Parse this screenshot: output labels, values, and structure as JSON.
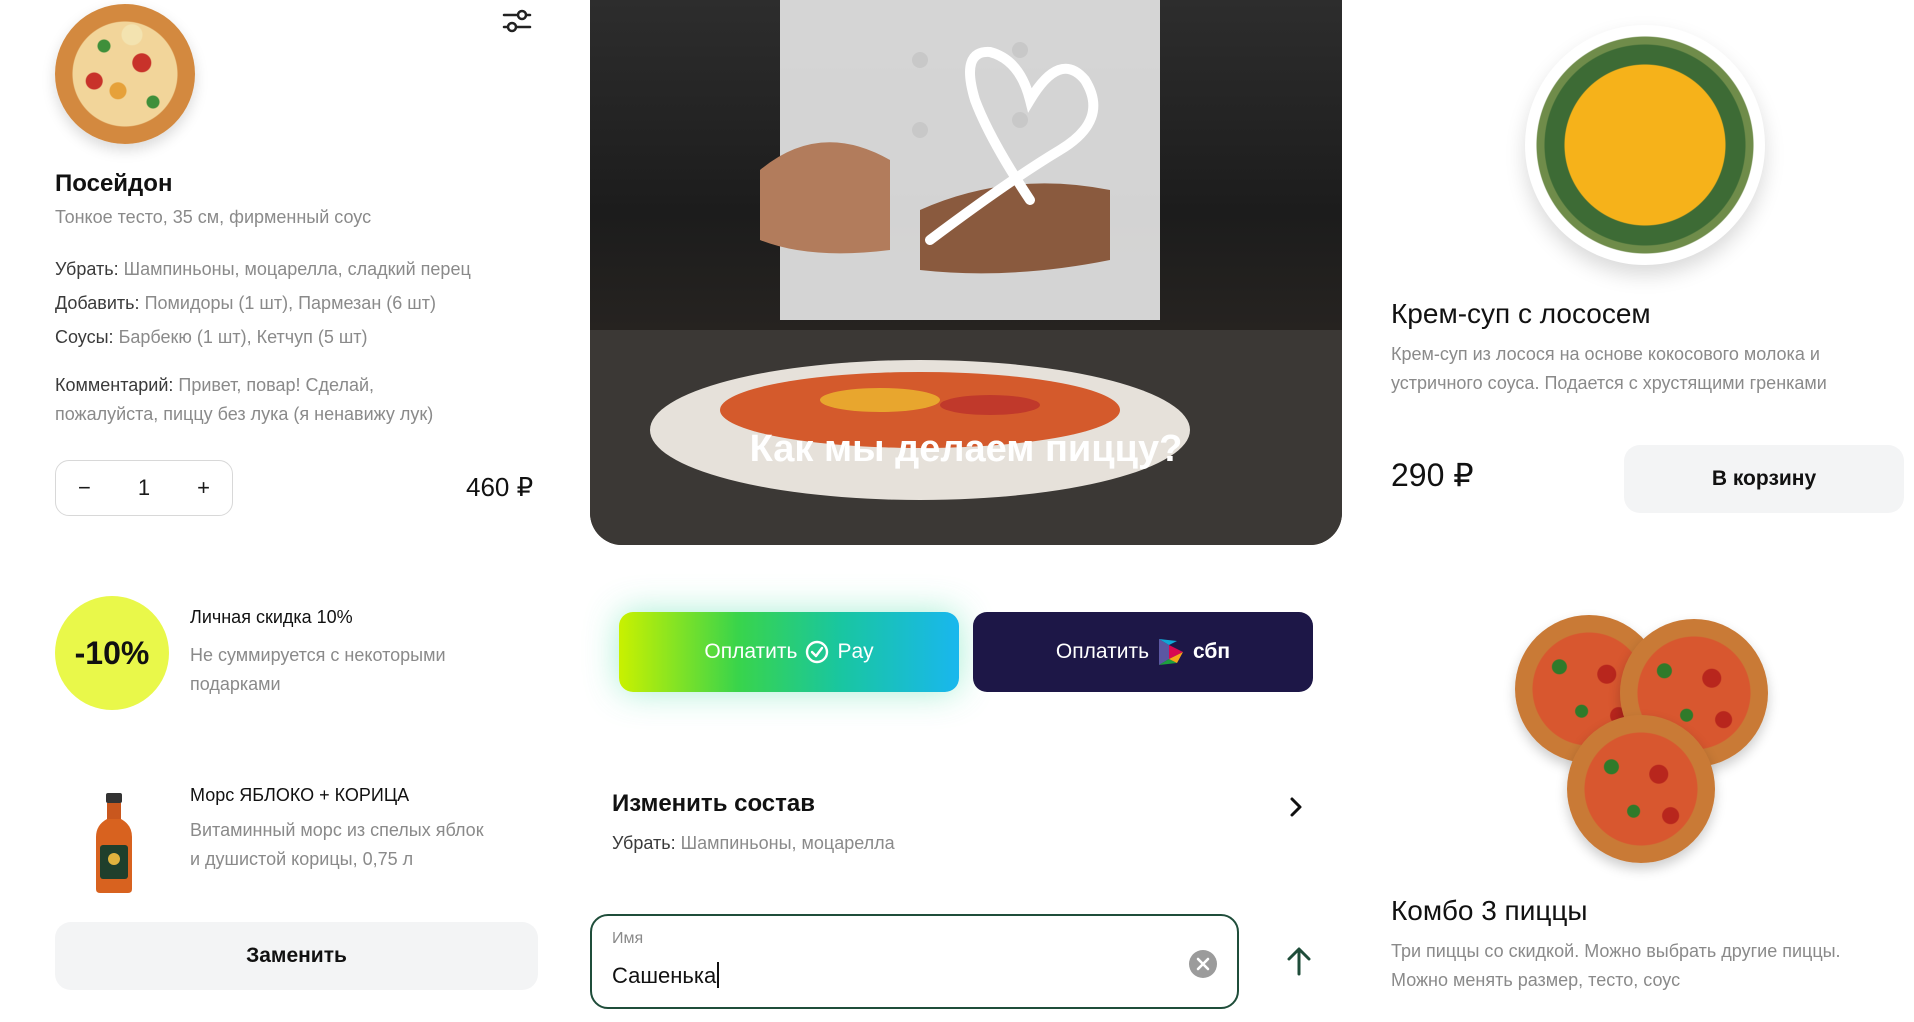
{
  "left": {
    "product": {
      "name": "Посейдон",
      "subtitle": "Тонкое тесто, 35 см, фирменный соус",
      "remove_label": "Убрать:",
      "remove_value": "Шампиньоны, моцарелла, сладкий перец",
      "add_label": "Добавить:",
      "add_value": "Помидоры (1 шт), Пармезан (6 шт)",
      "sauces_label": "Соусы:",
      "sauces_value": "Барбекю (1 шт), Кетчуп (5 шт)",
      "comment_label": "Комментарий:",
      "comment_value_line1": "Привет, повар! Сделай,",
      "comment_value_line2": "пожалуйста, пиццу без лука (я ненавижу лук)",
      "quantity": "1",
      "minus": "−",
      "plus": "+",
      "price": "460 ₽"
    },
    "discount": {
      "badge": "-10%",
      "title": "Личная скидка 10%",
      "description_line1": "Не суммируется с некоторыми",
      "description_line2": "подарками"
    },
    "drink": {
      "title": "Морс ЯБЛОКО + КОРИЦА",
      "description_line1": "Витаминный морс из спелых яблок",
      "description_line2": "и душистой корицы, 0,75 л",
      "replace_label": "Заменить"
    }
  },
  "center": {
    "hero_title": "Как мы делаем пиццу?",
    "pay_gpay_label": "Оплатить",
    "pay_gpay_brand": "Pay",
    "pay_sbp_label": "Оплатить",
    "pay_sbp_brand": "сбп",
    "change_title": "Изменить состав",
    "change_remove_label": "Убрать:",
    "change_remove_value": "Шампиньоны, моцарелла",
    "name_field": {
      "label": "Имя",
      "value": "Сашенька"
    }
  },
  "right": {
    "soup": {
      "title": "Крем-суп с лососем",
      "description_line1": "Крем-суп из лосося на основе кокосового молока и",
      "description_line2": "устричного соуса. Подается с хрустящими гренками",
      "price": "290 ₽",
      "cart_label": "В корзину"
    },
    "combo": {
      "title": "Комбо 3 пиццы",
      "description_line1": "Три пиццы со скидкой. Можно выбрать другие пиццы.",
      "description_line2": "Можно менять размер, тесто, соус"
    }
  },
  "colors": {
    "accent_dark_green": "#1f4d3a",
    "sbp_bg": "#1d1747",
    "discount_yellow": "#e9f84a",
    "button_gray": "#f3f4f5"
  },
  "icons": [
    "settings-sliders-icon",
    "close-circle-icon",
    "chevron-right-icon",
    "arrow-up-icon",
    "check-circle-icon",
    "sbp-logo-icon",
    "heart-icon"
  ]
}
